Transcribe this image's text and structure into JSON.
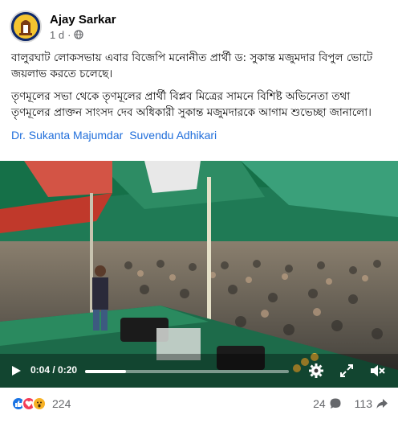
{
  "post": {
    "author": "Ajay Sarkar",
    "time": "1 d",
    "separator": "·"
  },
  "body": {
    "paragraph_1": "বালুরঘাট লোকসভায় এবার বিজেপি মনোনীত প্রার্থী ড: সুকান্ত মজুমদার বিপুল ভোটে জয়লাভ করতে চলেছে।",
    "paragraph_2": "তৃণমূলের সভা থেকে তৃণমূলের প্রার্থী বিপ্লব মিত্রের সামনে বিশিষ্ট অভিনেতা তথা তৃণমূলের প্রাক্তন সাংসদ দেব অধিকারী সুকান্ত মজুমদারকে আগাম শুভেচ্ছা জানালো।",
    "tags": [
      "Dr. Sukanta Majumdar",
      "Suvendu Adhikari"
    ]
  },
  "video": {
    "time_display": "0:04 / 0:20",
    "progress_fraction": 0.2,
    "icons": [
      "play-icon",
      "settings-icon",
      "fullscreen-icon",
      "volume-muted-icon"
    ]
  },
  "footer": {
    "reaction_icons": [
      "like-reaction-icon",
      "love-reaction-icon",
      "wow-reaction-icon"
    ],
    "reaction_count": "224",
    "comment_count": "24",
    "share_count": "113"
  },
  "colors": {
    "link": "#216fdb",
    "secondary_text": "#65676b",
    "like": "#1b74e4",
    "love": "#f33e58",
    "wow": "#f7b125"
  }
}
